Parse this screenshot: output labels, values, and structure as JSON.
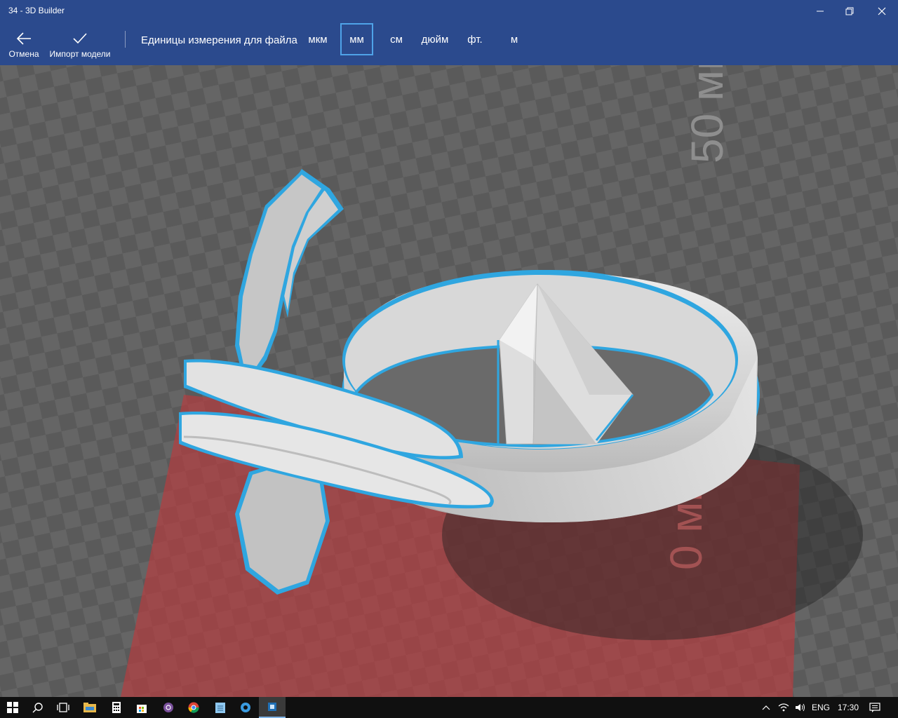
{
  "window": {
    "title": "34 - 3D Builder"
  },
  "commands": {
    "cancel_label": "Отмена",
    "import_label": "Импорт модели"
  },
  "units": {
    "label": "Единицы измерения для файла",
    "options": [
      "мкм",
      "мм",
      "см",
      "дюйм",
      "фт.",
      "м"
    ],
    "selected": "мм"
  },
  "viewport": {
    "scale_label_top": "50 мм",
    "scale_label_bottom": "0 мм",
    "plate_color": "#c0393c",
    "selection_color": "#2fa6e0"
  },
  "taskbar": {
    "language": "ENG",
    "clock": "17:30",
    "icons": [
      "windows-start-icon",
      "search-icon",
      "task-view-icon",
      "file-explorer-icon",
      "calculator-icon",
      "store-icon",
      "viber-icon",
      "chrome-icon",
      "notepad-icon",
      "settings-icon",
      "3d-builder-icon"
    ]
  }
}
